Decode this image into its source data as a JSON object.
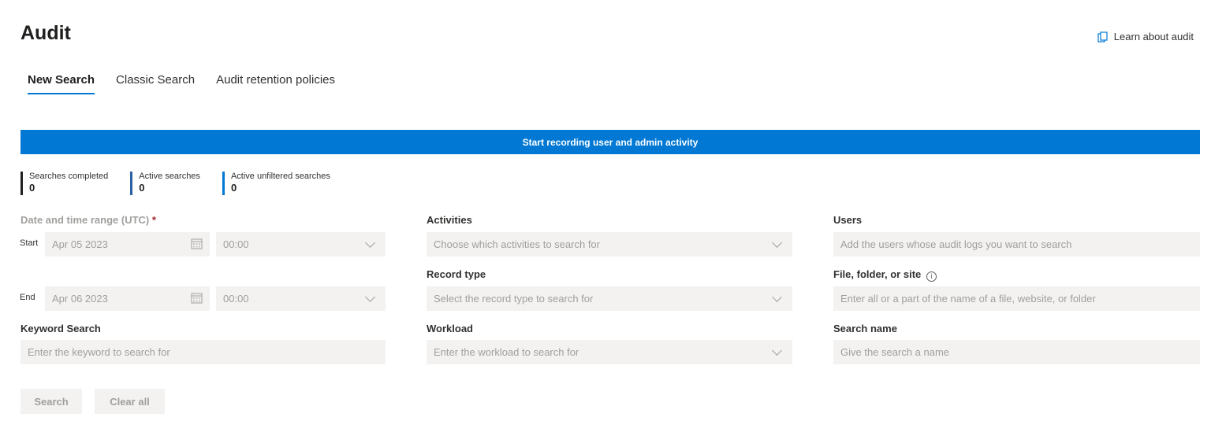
{
  "header": {
    "title": "Audit",
    "learn_link": "Learn about audit"
  },
  "tabs": [
    {
      "label": "New Search",
      "active": true
    },
    {
      "label": "Classic Search",
      "active": false
    },
    {
      "label": "Audit retention policies",
      "active": false
    }
  ],
  "banner": {
    "label": "Start recording user and admin activity"
  },
  "stats": [
    {
      "label": "Searches completed",
      "value": "0"
    },
    {
      "label": "Active searches",
      "value": "0"
    },
    {
      "label": "Active unfiltered searches",
      "value": "0"
    }
  ],
  "date_range": {
    "label": "Date and time range (UTC)",
    "required_mark": "*",
    "start_label": "Start",
    "start_date": "Apr 05 2023",
    "start_time": "00:00",
    "end_label": "End",
    "end_date": "Apr 06 2023",
    "end_time": "00:00"
  },
  "keyword": {
    "label": "Keyword Search",
    "placeholder": "Enter the keyword to search for"
  },
  "activities": {
    "label": "Activities",
    "placeholder": "Choose which activities to search for"
  },
  "record_type": {
    "label": "Record type",
    "placeholder": "Select the record type to search for"
  },
  "workload": {
    "label": "Workload",
    "placeholder": "Enter the workload to search for"
  },
  "users": {
    "label": "Users",
    "placeholder": "Add the users whose audit logs you want to search"
  },
  "file_folder": {
    "label": "File, folder, or site",
    "info": "i",
    "placeholder": "Enter all or a part of the name of a file, website, or folder"
  },
  "search_name": {
    "label": "Search name",
    "placeholder": "Give the search a name"
  },
  "buttons": {
    "search": "Search",
    "clear": "Clear all"
  },
  "colors": {
    "accent": "#0078d4",
    "field_bg": "#f3f2f1",
    "disabled_text": "#a19f9d"
  }
}
